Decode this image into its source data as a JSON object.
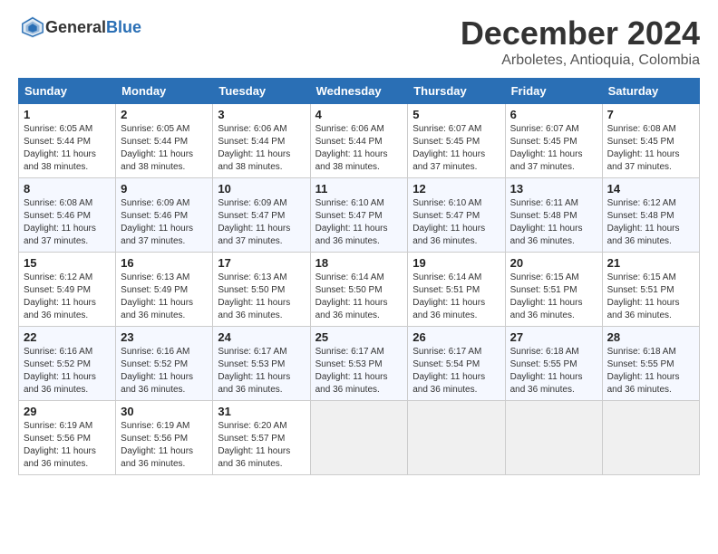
{
  "logo": {
    "general": "General",
    "blue": "Blue"
  },
  "header": {
    "month": "December 2024",
    "location": "Arboletes, Antioquia, Colombia"
  },
  "days_of_week": [
    "Sunday",
    "Monday",
    "Tuesday",
    "Wednesday",
    "Thursday",
    "Friday",
    "Saturday"
  ],
  "weeks": [
    [
      {
        "day": "1",
        "info": "Sunrise: 6:05 AM\nSunset: 5:44 PM\nDaylight: 11 hours\nand 38 minutes."
      },
      {
        "day": "2",
        "info": "Sunrise: 6:05 AM\nSunset: 5:44 PM\nDaylight: 11 hours\nand 38 minutes."
      },
      {
        "day": "3",
        "info": "Sunrise: 6:06 AM\nSunset: 5:44 PM\nDaylight: 11 hours\nand 38 minutes."
      },
      {
        "day": "4",
        "info": "Sunrise: 6:06 AM\nSunset: 5:44 PM\nDaylight: 11 hours\nand 38 minutes."
      },
      {
        "day": "5",
        "info": "Sunrise: 6:07 AM\nSunset: 5:45 PM\nDaylight: 11 hours\nand 37 minutes."
      },
      {
        "day": "6",
        "info": "Sunrise: 6:07 AM\nSunset: 5:45 PM\nDaylight: 11 hours\nand 37 minutes."
      },
      {
        "day": "7",
        "info": "Sunrise: 6:08 AM\nSunset: 5:45 PM\nDaylight: 11 hours\nand 37 minutes."
      }
    ],
    [
      {
        "day": "8",
        "info": "Sunrise: 6:08 AM\nSunset: 5:46 PM\nDaylight: 11 hours\nand 37 minutes."
      },
      {
        "day": "9",
        "info": "Sunrise: 6:09 AM\nSunset: 5:46 PM\nDaylight: 11 hours\nand 37 minutes."
      },
      {
        "day": "10",
        "info": "Sunrise: 6:09 AM\nSunset: 5:47 PM\nDaylight: 11 hours\nand 37 minutes."
      },
      {
        "day": "11",
        "info": "Sunrise: 6:10 AM\nSunset: 5:47 PM\nDaylight: 11 hours\nand 36 minutes."
      },
      {
        "day": "12",
        "info": "Sunrise: 6:10 AM\nSunset: 5:47 PM\nDaylight: 11 hours\nand 36 minutes."
      },
      {
        "day": "13",
        "info": "Sunrise: 6:11 AM\nSunset: 5:48 PM\nDaylight: 11 hours\nand 36 minutes."
      },
      {
        "day": "14",
        "info": "Sunrise: 6:12 AM\nSunset: 5:48 PM\nDaylight: 11 hours\nand 36 minutes."
      }
    ],
    [
      {
        "day": "15",
        "info": "Sunrise: 6:12 AM\nSunset: 5:49 PM\nDaylight: 11 hours\nand 36 minutes."
      },
      {
        "day": "16",
        "info": "Sunrise: 6:13 AM\nSunset: 5:49 PM\nDaylight: 11 hours\nand 36 minutes."
      },
      {
        "day": "17",
        "info": "Sunrise: 6:13 AM\nSunset: 5:50 PM\nDaylight: 11 hours\nand 36 minutes."
      },
      {
        "day": "18",
        "info": "Sunrise: 6:14 AM\nSunset: 5:50 PM\nDaylight: 11 hours\nand 36 minutes."
      },
      {
        "day": "19",
        "info": "Sunrise: 6:14 AM\nSunset: 5:51 PM\nDaylight: 11 hours\nand 36 minutes."
      },
      {
        "day": "20",
        "info": "Sunrise: 6:15 AM\nSunset: 5:51 PM\nDaylight: 11 hours\nand 36 minutes."
      },
      {
        "day": "21",
        "info": "Sunrise: 6:15 AM\nSunset: 5:51 PM\nDaylight: 11 hours\nand 36 minutes."
      }
    ],
    [
      {
        "day": "22",
        "info": "Sunrise: 6:16 AM\nSunset: 5:52 PM\nDaylight: 11 hours\nand 36 minutes."
      },
      {
        "day": "23",
        "info": "Sunrise: 6:16 AM\nSunset: 5:52 PM\nDaylight: 11 hours\nand 36 minutes."
      },
      {
        "day": "24",
        "info": "Sunrise: 6:17 AM\nSunset: 5:53 PM\nDaylight: 11 hours\nand 36 minutes."
      },
      {
        "day": "25",
        "info": "Sunrise: 6:17 AM\nSunset: 5:53 PM\nDaylight: 11 hours\nand 36 minutes."
      },
      {
        "day": "26",
        "info": "Sunrise: 6:17 AM\nSunset: 5:54 PM\nDaylight: 11 hours\nand 36 minutes."
      },
      {
        "day": "27",
        "info": "Sunrise: 6:18 AM\nSunset: 5:55 PM\nDaylight: 11 hours\nand 36 minutes."
      },
      {
        "day": "28",
        "info": "Sunrise: 6:18 AM\nSunset: 5:55 PM\nDaylight: 11 hours\nand 36 minutes."
      }
    ],
    [
      {
        "day": "29",
        "info": "Sunrise: 6:19 AM\nSunset: 5:56 PM\nDaylight: 11 hours\nand 36 minutes."
      },
      {
        "day": "30",
        "info": "Sunrise: 6:19 AM\nSunset: 5:56 PM\nDaylight: 11 hours\nand 36 minutes."
      },
      {
        "day": "31",
        "info": "Sunrise: 6:20 AM\nSunset: 5:57 PM\nDaylight: 11 hours\nand 36 minutes."
      },
      {
        "day": "",
        "info": ""
      },
      {
        "day": "",
        "info": ""
      },
      {
        "day": "",
        "info": ""
      },
      {
        "day": "",
        "info": ""
      }
    ]
  ]
}
